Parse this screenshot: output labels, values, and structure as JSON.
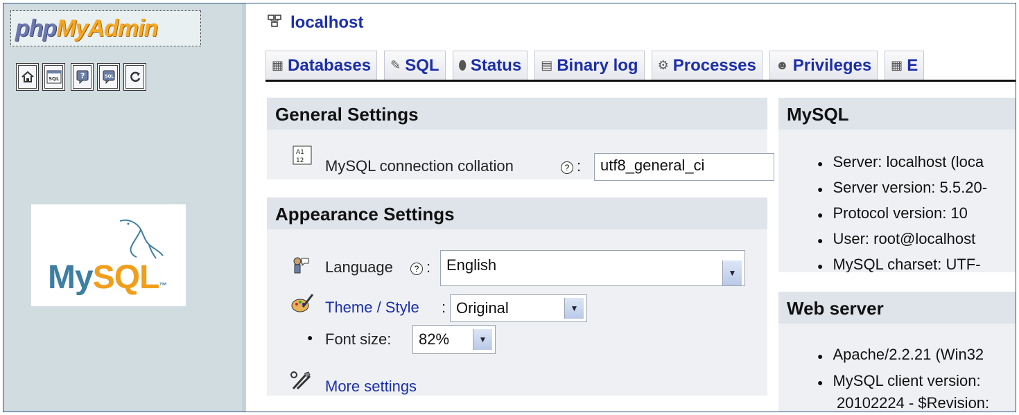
{
  "left_nav": {
    "logo": {
      "php": "php",
      "my": "My",
      "admin": "Admin"
    },
    "icons": [
      {
        "name": "home-icon",
        "glyph": "⌂"
      },
      {
        "name": "query-window-icon",
        "glyph": "SQL"
      },
      {
        "name": "documentation-icon",
        "glyph": "?"
      },
      {
        "name": "sql-docs-icon",
        "glyph": "?"
      },
      {
        "name": "reload-icon",
        "glyph": "⟳"
      }
    ],
    "mysql_logo": {
      "my": "My",
      "sql": "SQL",
      "tm": "™"
    }
  },
  "header": {
    "server_name": "localhost"
  },
  "tabs": [
    {
      "label": "Databases"
    },
    {
      "label": "SQL"
    },
    {
      "label": "Status"
    },
    {
      "label": "Binary log"
    },
    {
      "label": "Processes"
    },
    {
      "label": "Privileges"
    },
    {
      "label": "E"
    }
  ],
  "general_settings": {
    "title": "General Settings",
    "collation_label": "MySQL connection collation",
    "collation_value": "utf8_general_ci",
    "help": "?",
    "colon": ":"
  },
  "appearance_settings": {
    "title": "Appearance Settings",
    "language_label": "Language",
    "language_value": "English",
    "theme_label": "Theme / Style",
    "theme_value": "Original",
    "font_size_label": "Font size:",
    "font_size_value": "82%",
    "more_settings": "More settings",
    "help": "?",
    "colon": ":"
  },
  "mysql_panel": {
    "title": "MySQL",
    "items": [
      "Server: localhost (loca",
      "Server version: 5.5.20-",
      "Protocol version: 10",
      "User: root@localhost",
      "MySQL charset: UTF-"
    ]
  },
  "web_server_panel": {
    "title": "Web server",
    "items": [
      "Apache/2.2.21 (Win32",
      "MySQL client version:",
      "20102224 - $Revision:"
    ]
  },
  "colors": {
    "link": "#1c2fa8",
    "nav_bg": "#d0dce0",
    "section_header": "#dfe3ea",
    "section_body": "#eef0f3"
  }
}
